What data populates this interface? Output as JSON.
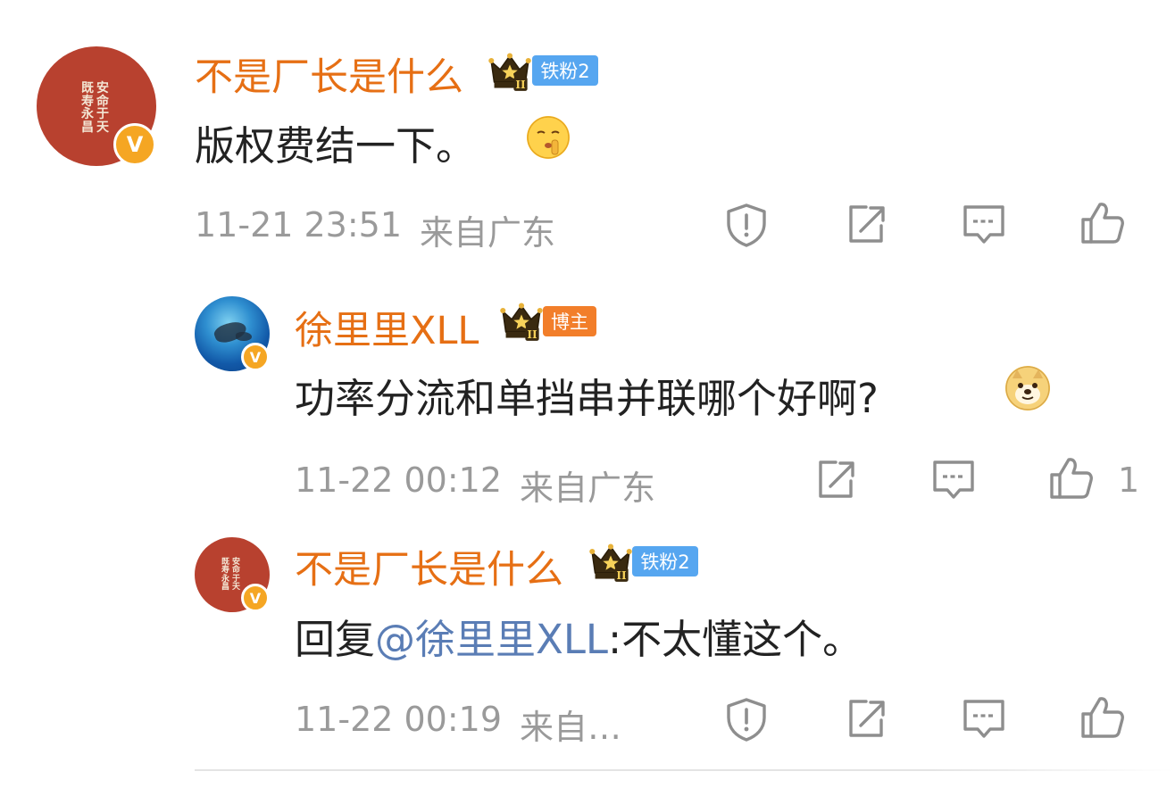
{
  "colors": {
    "username": "#e66f14",
    "mention": "#5a7db5",
    "fan_tag": "#56a6f0",
    "host_tag": "#f27e2a",
    "meta": "#9a9a9a",
    "verified": "#f5a623"
  },
  "comments": [
    {
      "username": "不是厂长是什么",
      "badge_tag": "铁粉2",
      "avatar_seal": [
        "安命于天",
        "既寿永昌"
      ],
      "verified_mark": "V",
      "text": "版权费结一下。",
      "emoji": "shush-emoji",
      "time": "11-21 23:51",
      "location": "来自广东",
      "actions": [
        "report-icon",
        "share-icon",
        "comment-icon",
        "like-icon"
      ],
      "like_count": ""
    },
    {
      "username": "徐里里XLL",
      "badge_tag": "博主",
      "verified_mark": "V",
      "text": "功率分流和单挡串并联哪个好啊?",
      "emoji": "doge-emoji",
      "time": "11-22 00:12",
      "location": "来自广东",
      "actions": [
        "share-icon",
        "comment-icon",
        "like-icon"
      ],
      "like_count": "1"
    },
    {
      "username": "不是厂长是什么",
      "badge_tag": "铁粉2",
      "avatar_seal": [
        "安命于天",
        "既寿永昌"
      ],
      "verified_mark": "V",
      "reply_prefix": "回复",
      "mention": "@徐里里XLL",
      "text_after": ":不太懂这个。",
      "time": "11-22 00:19",
      "location": "来自…",
      "actions": [
        "report-icon",
        "share-icon",
        "comment-icon",
        "like-icon"
      ],
      "like_count": ""
    }
  ]
}
